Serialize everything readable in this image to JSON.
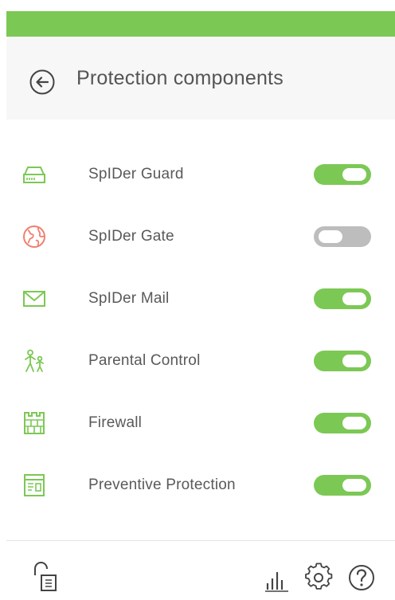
{
  "header": {
    "title": "Protection components",
    "back_icon": "back-arrow-circle-icon"
  },
  "components": [
    {
      "label": "SpIDer Guard",
      "icon": "drive-icon",
      "icon_color": "#7cc855",
      "enabled": true
    },
    {
      "label": "SpIDer Gate",
      "icon": "globe-icon",
      "icon_color": "#f08070",
      "enabled": false
    },
    {
      "label": "SpIDer Mail",
      "icon": "envelope-icon",
      "icon_color": "#7cc855",
      "enabled": true
    },
    {
      "label": "Parental Control",
      "icon": "parent-child-icon",
      "icon_color": "#7cc855",
      "enabled": true
    },
    {
      "label": "Firewall",
      "icon": "castle-wall-icon",
      "icon_color": "#7cc855",
      "enabled": true
    },
    {
      "label": "Preventive Protection",
      "icon": "app-window-icon",
      "icon_color": "#7cc855",
      "enabled": true
    }
  ],
  "footer": {
    "lock_icon": "padlock-open-icon",
    "stats_icon": "bar-chart-icon",
    "settings_icon": "gear-icon",
    "help_icon": "help-circle-icon"
  },
  "colors": {
    "accent": "#7cc855",
    "toggle_off": "#bdbdbd",
    "header_bg": "#f7f7f7",
    "text": "#555555"
  }
}
